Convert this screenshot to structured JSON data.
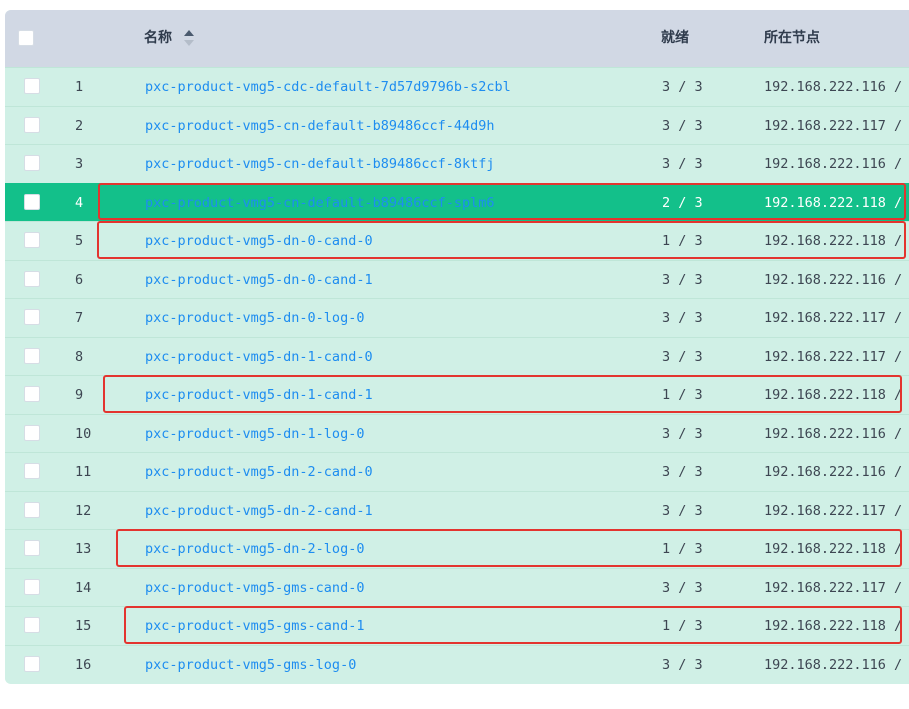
{
  "table": {
    "headers": {
      "name": "名称",
      "ready": "就绪",
      "node": "所在节点"
    },
    "rows": [
      {
        "index": "1",
        "name": "pxc-product-vmg5-cdc-default-7d57d9796b-s2cbl",
        "ready": "3 / 3",
        "node": "192.168.222.116 /",
        "selected": false,
        "highlighted": false
      },
      {
        "index": "2",
        "name": "pxc-product-vmg5-cn-default-b89486ccf-44d9h",
        "ready": "3 / 3",
        "node": "192.168.222.117 /",
        "selected": false,
        "highlighted": false
      },
      {
        "index": "3",
        "name": "pxc-product-vmg5-cn-default-b89486ccf-8ktfj",
        "ready": "3 / 3",
        "node": "192.168.222.116 /",
        "selected": false,
        "highlighted": false
      },
      {
        "index": "4",
        "name": "pxc-product-vmg5-cn-default-b89486ccf-splm6",
        "ready": "2 / 3",
        "node": "192.168.222.118 /",
        "selected": true,
        "highlighted": true
      },
      {
        "index": "5",
        "name": "pxc-product-vmg5-dn-0-cand-0",
        "ready": "1 / 3",
        "node": "192.168.222.118 /",
        "selected": false,
        "highlighted": true
      },
      {
        "index": "6",
        "name": "pxc-product-vmg5-dn-0-cand-1",
        "ready": "3 / 3",
        "node": "192.168.222.116 /",
        "selected": false,
        "highlighted": false
      },
      {
        "index": "7",
        "name": "pxc-product-vmg5-dn-0-log-0",
        "ready": "3 / 3",
        "node": "192.168.222.117 /",
        "selected": false,
        "highlighted": false
      },
      {
        "index": "8",
        "name": "pxc-product-vmg5-dn-1-cand-0",
        "ready": "3 / 3",
        "node": "192.168.222.117 /",
        "selected": false,
        "highlighted": false
      },
      {
        "index": "9",
        "name": "pxc-product-vmg5-dn-1-cand-1",
        "ready": "1 / 3",
        "node": "192.168.222.118 /",
        "selected": false,
        "highlighted": true
      },
      {
        "index": "10",
        "name": "pxc-product-vmg5-dn-1-log-0",
        "ready": "3 / 3",
        "node": "192.168.222.116 /",
        "selected": false,
        "highlighted": false
      },
      {
        "index": "11",
        "name": "pxc-product-vmg5-dn-2-cand-0",
        "ready": "3 / 3",
        "node": "192.168.222.116 /",
        "selected": false,
        "highlighted": false
      },
      {
        "index": "12",
        "name": "pxc-product-vmg5-dn-2-cand-1",
        "ready": "3 / 3",
        "node": "192.168.222.117 /",
        "selected": false,
        "highlighted": false
      },
      {
        "index": "13",
        "name": "pxc-product-vmg5-dn-2-log-0",
        "ready": "1 / 3",
        "node": "192.168.222.118 /",
        "selected": false,
        "highlighted": true
      },
      {
        "index": "14",
        "name": "pxc-product-vmg5-gms-cand-0",
        "ready": "3 / 3",
        "node": "192.168.222.117 /",
        "selected": false,
        "highlighted": false
      },
      {
        "index": "15",
        "name": "pxc-product-vmg5-gms-cand-1",
        "ready": "1 / 3",
        "node": "192.168.222.118 /",
        "selected": false,
        "highlighted": true
      },
      {
        "index": "16",
        "name": "pxc-product-vmg5-gms-log-0",
        "ready": "3 / 3",
        "node": "192.168.222.116 /",
        "selected": false,
        "highlighted": false
      }
    ]
  },
  "colors": {
    "header_bg": "#d1d8e4",
    "row_bg": "#d0f0e6",
    "selected_row_bg": "#13c08a",
    "link": "#1e8df0",
    "highlight_border": "#e3342f"
  },
  "icons": {
    "sort": "sort-icon",
    "checkbox": "checkbox-icon"
  }
}
